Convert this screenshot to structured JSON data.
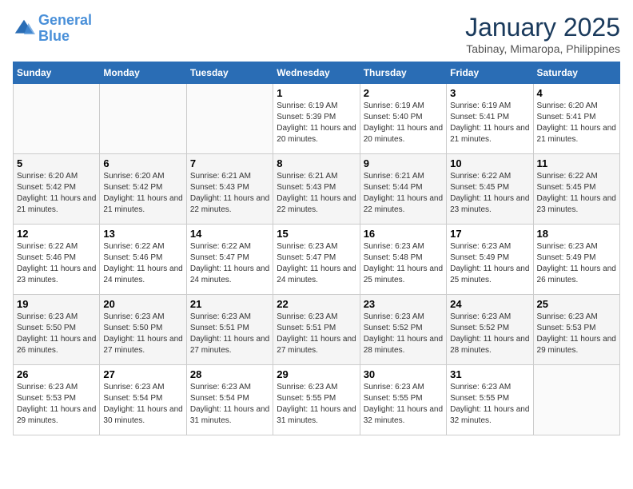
{
  "logo": {
    "line1": "General",
    "line2": "Blue"
  },
  "title": "January 2025",
  "subtitle": "Tabinay, Mimaropa, Philippines",
  "weekdays": [
    "Sunday",
    "Monday",
    "Tuesday",
    "Wednesday",
    "Thursday",
    "Friday",
    "Saturday"
  ],
  "weeks": [
    [
      {
        "day": "",
        "sunrise": "",
        "sunset": "",
        "daylight": ""
      },
      {
        "day": "",
        "sunrise": "",
        "sunset": "",
        "daylight": ""
      },
      {
        "day": "",
        "sunrise": "",
        "sunset": "",
        "daylight": ""
      },
      {
        "day": "1",
        "sunrise": "Sunrise: 6:19 AM",
        "sunset": "Sunset: 5:39 PM",
        "daylight": "Daylight: 11 hours and 20 minutes."
      },
      {
        "day": "2",
        "sunrise": "Sunrise: 6:19 AM",
        "sunset": "Sunset: 5:40 PM",
        "daylight": "Daylight: 11 hours and 20 minutes."
      },
      {
        "day": "3",
        "sunrise": "Sunrise: 6:19 AM",
        "sunset": "Sunset: 5:41 PM",
        "daylight": "Daylight: 11 hours and 21 minutes."
      },
      {
        "day": "4",
        "sunrise": "Sunrise: 6:20 AM",
        "sunset": "Sunset: 5:41 PM",
        "daylight": "Daylight: 11 hours and 21 minutes."
      }
    ],
    [
      {
        "day": "5",
        "sunrise": "Sunrise: 6:20 AM",
        "sunset": "Sunset: 5:42 PM",
        "daylight": "Daylight: 11 hours and 21 minutes."
      },
      {
        "day": "6",
        "sunrise": "Sunrise: 6:20 AM",
        "sunset": "Sunset: 5:42 PM",
        "daylight": "Daylight: 11 hours and 21 minutes."
      },
      {
        "day": "7",
        "sunrise": "Sunrise: 6:21 AM",
        "sunset": "Sunset: 5:43 PM",
        "daylight": "Daylight: 11 hours and 22 minutes."
      },
      {
        "day": "8",
        "sunrise": "Sunrise: 6:21 AM",
        "sunset": "Sunset: 5:43 PM",
        "daylight": "Daylight: 11 hours and 22 minutes."
      },
      {
        "day": "9",
        "sunrise": "Sunrise: 6:21 AM",
        "sunset": "Sunset: 5:44 PM",
        "daylight": "Daylight: 11 hours and 22 minutes."
      },
      {
        "day": "10",
        "sunrise": "Sunrise: 6:22 AM",
        "sunset": "Sunset: 5:45 PM",
        "daylight": "Daylight: 11 hours and 23 minutes."
      },
      {
        "day": "11",
        "sunrise": "Sunrise: 6:22 AM",
        "sunset": "Sunset: 5:45 PM",
        "daylight": "Daylight: 11 hours and 23 minutes."
      }
    ],
    [
      {
        "day": "12",
        "sunrise": "Sunrise: 6:22 AM",
        "sunset": "Sunset: 5:46 PM",
        "daylight": "Daylight: 11 hours and 23 minutes."
      },
      {
        "day": "13",
        "sunrise": "Sunrise: 6:22 AM",
        "sunset": "Sunset: 5:46 PM",
        "daylight": "Daylight: 11 hours and 24 minutes."
      },
      {
        "day": "14",
        "sunrise": "Sunrise: 6:22 AM",
        "sunset": "Sunset: 5:47 PM",
        "daylight": "Daylight: 11 hours and 24 minutes."
      },
      {
        "day": "15",
        "sunrise": "Sunrise: 6:23 AM",
        "sunset": "Sunset: 5:47 PM",
        "daylight": "Daylight: 11 hours and 24 minutes."
      },
      {
        "day": "16",
        "sunrise": "Sunrise: 6:23 AM",
        "sunset": "Sunset: 5:48 PM",
        "daylight": "Daylight: 11 hours and 25 minutes."
      },
      {
        "day": "17",
        "sunrise": "Sunrise: 6:23 AM",
        "sunset": "Sunset: 5:49 PM",
        "daylight": "Daylight: 11 hours and 25 minutes."
      },
      {
        "day": "18",
        "sunrise": "Sunrise: 6:23 AM",
        "sunset": "Sunset: 5:49 PM",
        "daylight": "Daylight: 11 hours and 26 minutes."
      }
    ],
    [
      {
        "day": "19",
        "sunrise": "Sunrise: 6:23 AM",
        "sunset": "Sunset: 5:50 PM",
        "daylight": "Daylight: 11 hours and 26 minutes."
      },
      {
        "day": "20",
        "sunrise": "Sunrise: 6:23 AM",
        "sunset": "Sunset: 5:50 PM",
        "daylight": "Daylight: 11 hours and 27 minutes."
      },
      {
        "day": "21",
        "sunrise": "Sunrise: 6:23 AM",
        "sunset": "Sunset: 5:51 PM",
        "daylight": "Daylight: 11 hours and 27 minutes."
      },
      {
        "day": "22",
        "sunrise": "Sunrise: 6:23 AM",
        "sunset": "Sunset: 5:51 PM",
        "daylight": "Daylight: 11 hours and 27 minutes."
      },
      {
        "day": "23",
        "sunrise": "Sunrise: 6:23 AM",
        "sunset": "Sunset: 5:52 PM",
        "daylight": "Daylight: 11 hours and 28 minutes."
      },
      {
        "day": "24",
        "sunrise": "Sunrise: 6:23 AM",
        "sunset": "Sunset: 5:52 PM",
        "daylight": "Daylight: 11 hours and 28 minutes."
      },
      {
        "day": "25",
        "sunrise": "Sunrise: 6:23 AM",
        "sunset": "Sunset: 5:53 PM",
        "daylight": "Daylight: 11 hours and 29 minutes."
      }
    ],
    [
      {
        "day": "26",
        "sunrise": "Sunrise: 6:23 AM",
        "sunset": "Sunset: 5:53 PM",
        "daylight": "Daylight: 11 hours and 29 minutes."
      },
      {
        "day": "27",
        "sunrise": "Sunrise: 6:23 AM",
        "sunset": "Sunset: 5:54 PM",
        "daylight": "Daylight: 11 hours and 30 minutes."
      },
      {
        "day": "28",
        "sunrise": "Sunrise: 6:23 AM",
        "sunset": "Sunset: 5:54 PM",
        "daylight": "Daylight: 11 hours and 31 minutes."
      },
      {
        "day": "29",
        "sunrise": "Sunrise: 6:23 AM",
        "sunset": "Sunset: 5:55 PM",
        "daylight": "Daylight: 11 hours and 31 minutes."
      },
      {
        "day": "30",
        "sunrise": "Sunrise: 6:23 AM",
        "sunset": "Sunset: 5:55 PM",
        "daylight": "Daylight: 11 hours and 32 minutes."
      },
      {
        "day": "31",
        "sunrise": "Sunrise: 6:23 AM",
        "sunset": "Sunset: 5:55 PM",
        "daylight": "Daylight: 11 hours and 32 minutes."
      },
      {
        "day": "",
        "sunrise": "",
        "sunset": "",
        "daylight": ""
      }
    ]
  ]
}
